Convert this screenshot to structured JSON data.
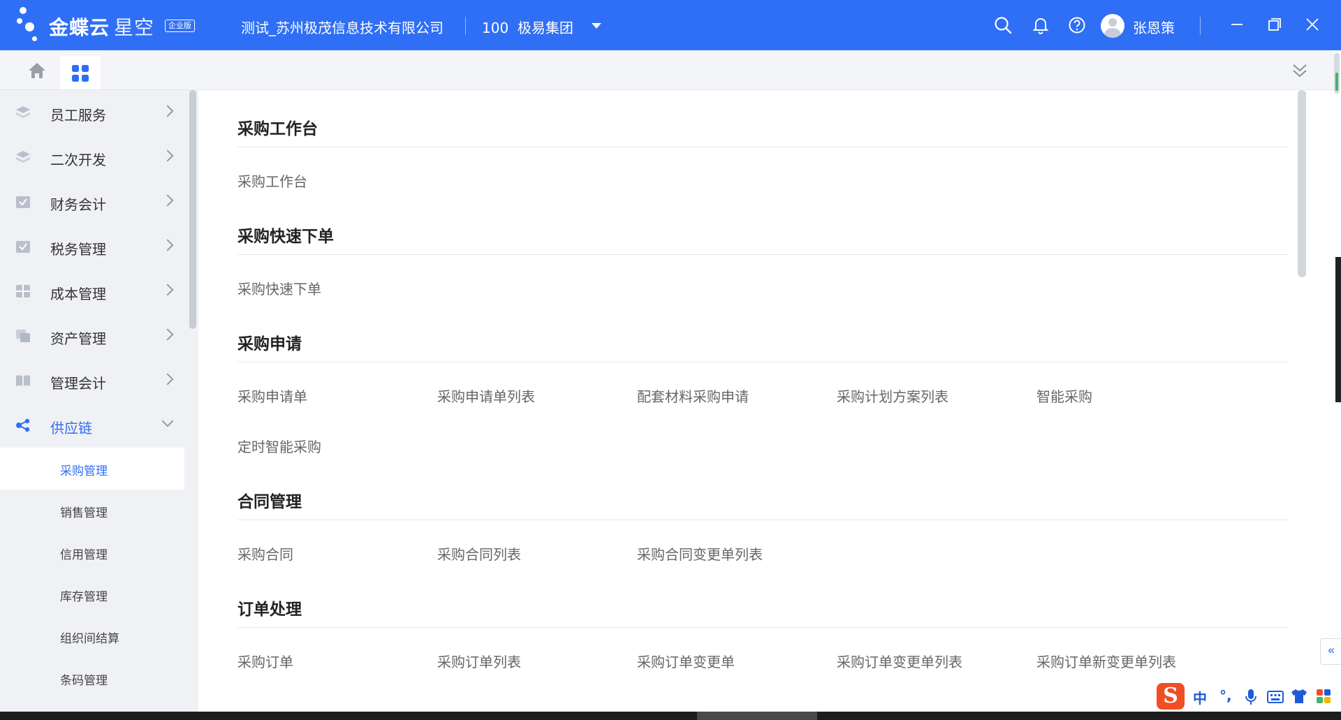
{
  "header": {
    "logo_text": "金蝶云",
    "logo_text_light": "星空",
    "logo_badge": "企业版",
    "company": "测试_苏州极茂信息技术有限公司",
    "org_code": "100",
    "org_name": "极易集团",
    "username": "张恩策",
    "icons": [
      "search-icon",
      "bell-icon",
      "help-icon",
      "minimize-icon",
      "restore-icon",
      "close-icon"
    ]
  },
  "tabs": {
    "home_icon": "home-icon",
    "apps_icon": "apps-grid-icon",
    "collapse_icon": "double-chevron-down-icon"
  },
  "sidebar": {
    "items": [
      {
        "label": "员工服务",
        "icon": "layers-icon"
      },
      {
        "label": "二次开发",
        "icon": "layers-icon"
      },
      {
        "label": "财务会计",
        "icon": "checklist-icon"
      },
      {
        "label": "税务管理",
        "icon": "checklist-icon"
      },
      {
        "label": "成本管理",
        "icon": "grid-icon"
      },
      {
        "label": "资产管理",
        "icon": "asset-icon"
      },
      {
        "label": "管理会计",
        "icon": "book-icon"
      },
      {
        "label": "供应链",
        "icon": "share-nodes-icon"
      }
    ],
    "sub_items": [
      {
        "label": "采购管理"
      },
      {
        "label": "销售管理"
      },
      {
        "label": "信用管理"
      },
      {
        "label": "库存管理"
      },
      {
        "label": "组织间结算"
      },
      {
        "label": "条码管理"
      }
    ]
  },
  "main": {
    "sections": [
      {
        "title": "采购工作台",
        "links": [
          "采购工作台"
        ]
      },
      {
        "title": "采购快速下单",
        "links": [
          "采购快速下单"
        ]
      },
      {
        "title": "采购申请",
        "links": [
          "采购申请单",
          "采购申请单列表",
          "配套材料采购申请",
          "采购计划方案列表",
          "智能采购",
          "定时智能采购"
        ]
      },
      {
        "title": "合同管理",
        "links": [
          "采购合同",
          "采购合同列表",
          "采购合同变更单列表"
        ]
      },
      {
        "title": "订单处理",
        "links": [
          "采购订单",
          "采购订单列表",
          "采购订单变更单",
          "采购订单变更单列表",
          "采购订单新变更单列表"
        ]
      }
    ]
  },
  "ime": {
    "logo": "S",
    "mode": "中",
    "punct": "°,"
  },
  "colors": {
    "brand": "#2f6ff5",
    "sidebar_bg": "#f0f1f5"
  }
}
